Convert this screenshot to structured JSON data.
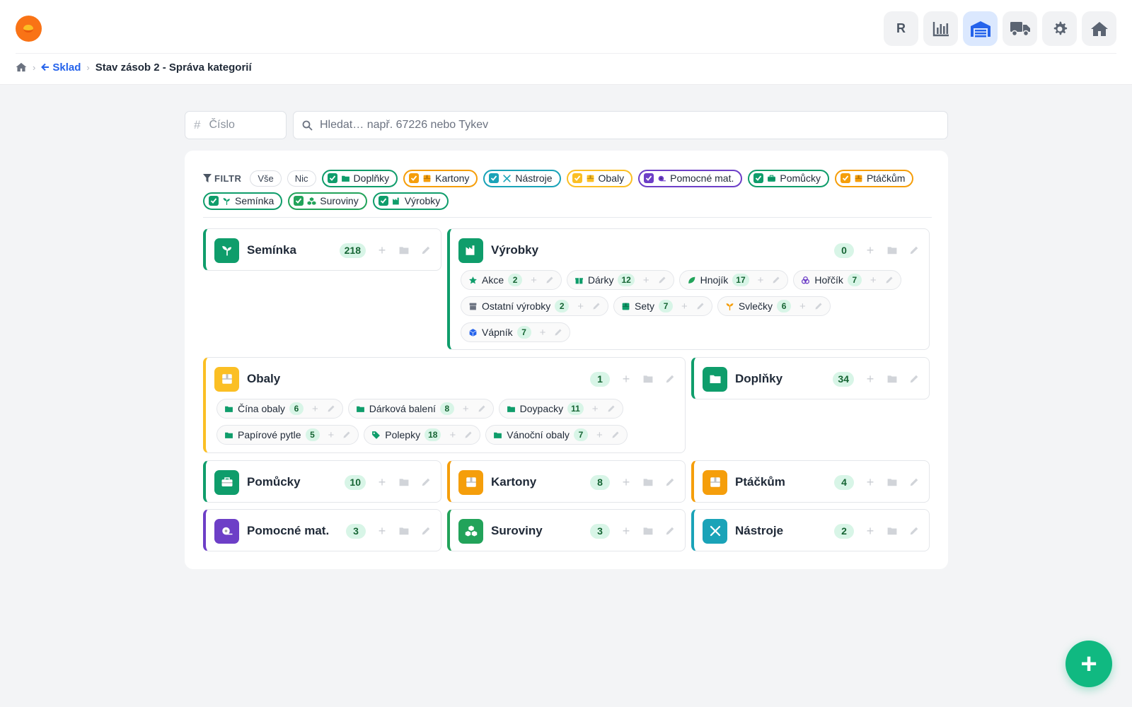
{
  "header": {
    "logo_icon": "app-logo",
    "nav": [
      {
        "name": "nav-reports",
        "label": "R",
        "icon": "letter-r"
      },
      {
        "name": "nav-stats",
        "icon": "bar-chart-icon"
      },
      {
        "name": "nav-warehouse",
        "icon": "warehouse-icon",
        "active": true
      },
      {
        "name": "nav-shipping",
        "icon": "truck-icon"
      },
      {
        "name": "nav-settings",
        "icon": "gear-icon"
      },
      {
        "name": "nav-home",
        "icon": "home-icon"
      }
    ]
  },
  "breadcrumb": {
    "home_icon": "home-icon",
    "back_label": "Sklad",
    "current": "Stav zásob 2 - Správa kategorií"
  },
  "search": {
    "number_placeholder": "Číslo",
    "query_placeholder": "Hledat… např. 67226 nebo Tykev"
  },
  "filter": {
    "label": "FILTR",
    "all_label": "Vše",
    "none_label": "Nic",
    "chips": [
      {
        "label": "Doplňky",
        "color": "#0f9d6b",
        "icon": "folder-icon",
        "checked": true
      },
      {
        "label": "Kartony",
        "color": "#f59e0b",
        "icon": "box-icon",
        "checked": true
      },
      {
        "label": "Nástroje",
        "color": "#1aa3b8",
        "icon": "tools-icon",
        "checked": true
      },
      {
        "label": "Obaly",
        "color": "#fbbf24",
        "icon": "box-icon",
        "checked": true
      },
      {
        "label": "Pomocné mat.",
        "color": "#6d3fc7",
        "icon": "tape-icon",
        "checked": true
      },
      {
        "label": "Pomůcky",
        "color": "#0f9d6b",
        "icon": "toolbox-icon",
        "checked": true
      },
      {
        "label": "Ptáčkům",
        "color": "#f59e0b",
        "icon": "box-icon",
        "checked": true
      },
      {
        "label": "Semínka",
        "color": "#0f9d6b",
        "icon": "seedling-icon",
        "checked": true
      },
      {
        "label": "Suroviny",
        "color": "#22a35a",
        "icon": "cubes-icon",
        "checked": true
      },
      {
        "label": "Výrobky",
        "color": "#0f9d6b",
        "icon": "factory-icon",
        "checked": true
      }
    ]
  },
  "categories": {
    "seminka": {
      "name": "Semínka",
      "count": "218",
      "color": "#0f9d6b",
      "icon": "seedling-icon"
    },
    "vyrobky": {
      "name": "Výrobky",
      "count": "0",
      "color": "#0f9d6b",
      "icon": "factory-icon",
      "subs": [
        {
          "name": "Akce",
          "count": "2",
          "icon": "star-icon"
        },
        {
          "name": "Dárky",
          "count": "12",
          "icon": "gift-icon"
        },
        {
          "name": "Hnojík",
          "count": "17",
          "icon": "leaf-icon"
        },
        {
          "name": "Hořčík",
          "count": "7",
          "icon": "atoms-icon"
        },
        {
          "name": "Ostatní výrobky",
          "count": "2",
          "icon": "archive-icon"
        },
        {
          "name": "Sety",
          "count": "7",
          "icon": "box-icon"
        },
        {
          "name": "Svlečky",
          "count": "6",
          "icon": "sprout-icon"
        },
        {
          "name": "Vápník",
          "count": "7",
          "icon": "cube-icon"
        }
      ]
    },
    "obaly": {
      "name": "Obaly",
      "count": "1",
      "color": "#fbbf24",
      "icon": "box-icon",
      "subs": [
        {
          "name": "Čína obaly",
          "count": "6",
          "icon": "folder-icon"
        },
        {
          "name": "Dárková balení",
          "count": "8",
          "icon": "folder-icon"
        },
        {
          "name": "Doypacky",
          "count": "11",
          "icon": "folder-icon"
        },
        {
          "name": "Papírové pytle",
          "count": "5",
          "icon": "folder-icon"
        },
        {
          "name": "Polepky",
          "count": "18",
          "icon": "tag-icon"
        },
        {
          "name": "Vánoční obaly",
          "count": "7",
          "icon": "folder-icon"
        }
      ]
    },
    "doplnky": {
      "name": "Doplňky",
      "count": "34",
      "color": "#0f9d6b",
      "icon": "folder-icon"
    },
    "pomucky": {
      "name": "Pomůcky",
      "count": "10",
      "color": "#0f9d6b",
      "icon": "toolbox-icon"
    },
    "kartony": {
      "name": "Kartony",
      "count": "8",
      "color": "#f59e0b",
      "icon": "box-icon"
    },
    "ptackum": {
      "name": "Ptáčkům",
      "count": "4",
      "color": "#f59e0b",
      "icon": "box-icon"
    },
    "pomocne": {
      "name": "Pomocné mat.",
      "count": "3",
      "color": "#6d3fc7",
      "icon": "tape-icon"
    },
    "suroviny": {
      "name": "Suroviny",
      "count": "3",
      "color": "#22a35a",
      "icon": "cubes-icon"
    },
    "nastroje": {
      "name": "Nástroje",
      "count": "2",
      "color": "#1aa3b8",
      "icon": "tools-icon"
    }
  },
  "fab_label": "+"
}
